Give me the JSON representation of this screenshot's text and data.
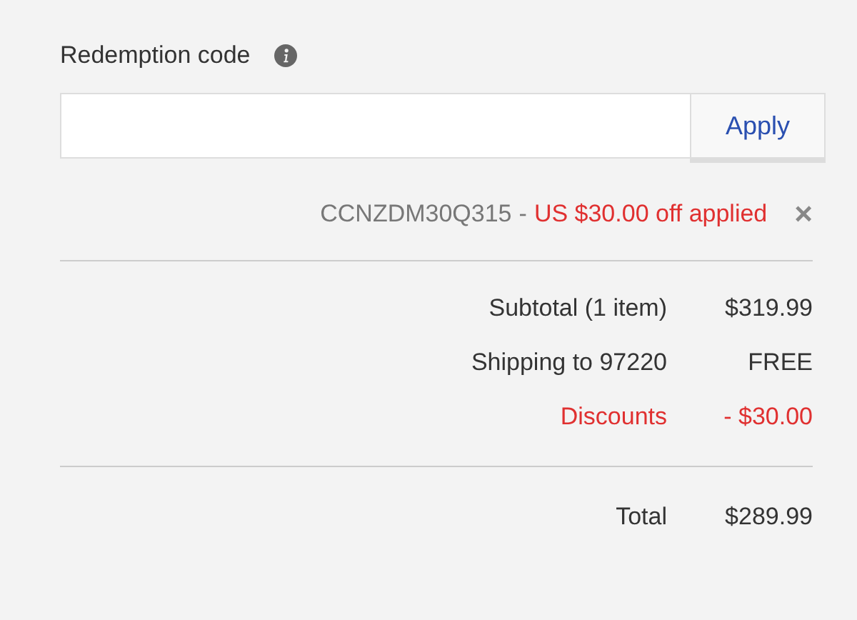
{
  "redemption": {
    "label": "Redemption code",
    "button": "Apply"
  },
  "applied_code": {
    "code": "CCNZDM30Q315",
    "separator": "-",
    "message": "US $30.00 off applied",
    "remove": "×"
  },
  "summary": [
    {
      "kind": "normal",
      "label": "Subtotal (1 item)",
      "value": "$319.99"
    },
    {
      "kind": "normal",
      "label": "Shipping to 97220",
      "value": "FREE"
    },
    {
      "kind": "discount",
      "label": "Discounts",
      "value": "- $30.00"
    }
  ],
  "total": {
    "label": "Total",
    "value": "$289.99"
  }
}
